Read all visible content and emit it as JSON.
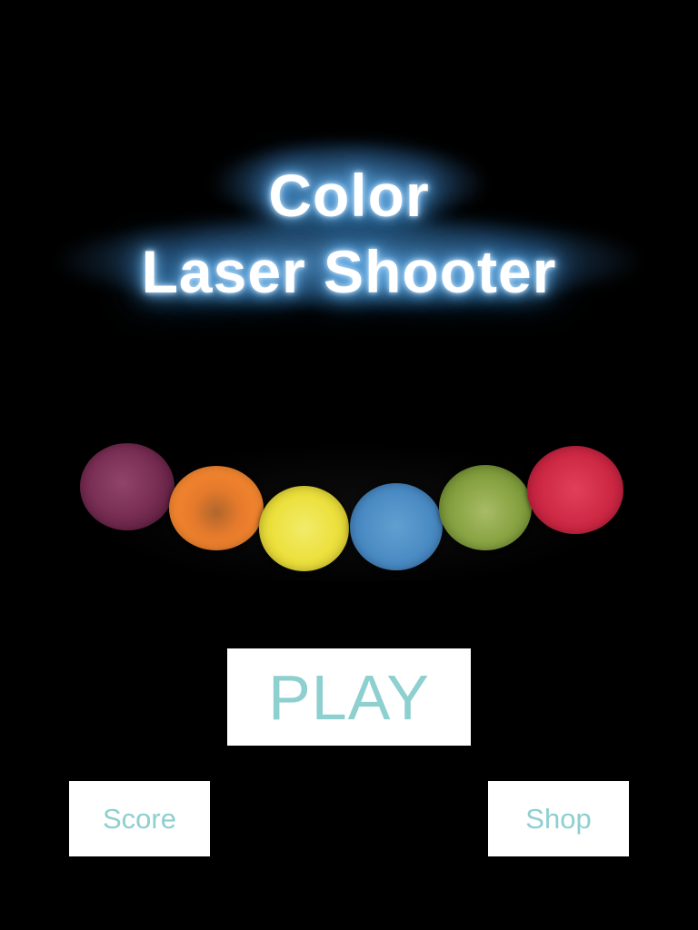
{
  "title": {
    "line1": "Color",
    "line2": "Laser Shooter",
    "glow_color": "#5ab4ff",
    "text_color": "#ffffff"
  },
  "balls": [
    {
      "name": "purple-ball",
      "color": "#7a2f55"
    },
    {
      "name": "orange-ball",
      "color": "#f3862f"
    },
    {
      "name": "yellow-ball",
      "color": "#ece13f"
    },
    {
      "name": "blue-ball",
      "color": "#4d8dc5"
    },
    {
      "name": "green-ball",
      "color": "#8aa544"
    },
    {
      "name": "red-ball",
      "color": "#cf2a46"
    }
  ],
  "buttons": {
    "play_label": "PLAY",
    "score_label": "Score",
    "shop_label": "Shop",
    "text_color": "#8ecfd0",
    "background": "#ffffff"
  },
  "background": "#000000"
}
